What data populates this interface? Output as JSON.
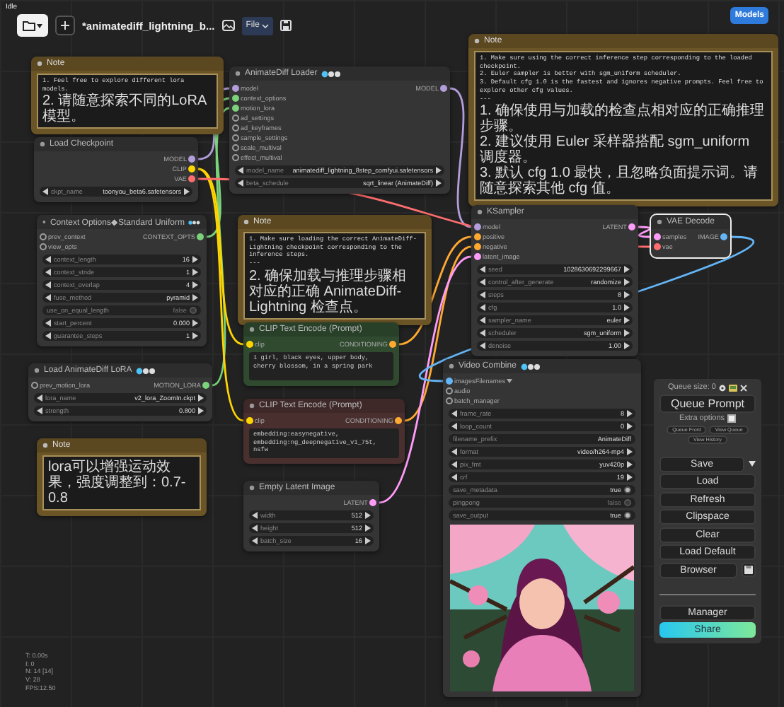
{
  "status": "Idle",
  "toolbar": {
    "workflow_title": "*animatediff_lightning_b...",
    "menu": "File",
    "models_button": "Models"
  },
  "nodes": [
    {
      "kind": "note",
      "title": "Note",
      "color": "#6b5426",
      "selected": false,
      "lines": [
        {
          "kind": "latin",
          "text": "1. Feel free to explore different lora models."
        },
        {
          "kind": "cjk",
          "text": "2. 请随意探索不同的LoRA模型。"
        }
      ]
    },
    {
      "kind": "node",
      "title": "Load Checkpoint",
      "color": "#353535",
      "selected": false,
      "badges": false,
      "outputs": [
        {
          "name": "MODEL",
          "color": "#b39ddb"
        },
        {
          "name": "CLIP",
          "color": "#ffd500"
        },
        {
          "name": "VAE",
          "color": "#ff6e6e"
        }
      ],
      "widgets": [
        {
          "kind": "stepper",
          "name": "ckpt_name",
          "value": "toonyou_beta6.safetensors"
        }
      ]
    },
    {
      "kind": "node",
      "title": "Context Options◆Standard Uniform",
      "color": "#353535",
      "selected": false,
      "badges": true,
      "inputs": [
        {
          "name": "prev_context",
          "color": "#9e9e9e",
          "linked": false
        },
        {
          "name": "view_opts",
          "color": "#9e9e9e",
          "linked": false
        }
      ],
      "outputs": [
        {
          "name": "CONTEXT_OPTS",
          "color": "#7bd37b"
        }
      ],
      "widgets": [
        {
          "kind": "stepper",
          "name": "context_length",
          "value": "16"
        },
        {
          "kind": "stepper",
          "name": "context_stride",
          "value": "1"
        },
        {
          "kind": "stepper",
          "name": "context_overlap",
          "value": "4"
        },
        {
          "kind": "stepper",
          "name": "fuse_method",
          "value": "pyramid"
        },
        {
          "kind": "toggle",
          "name": "use_on_equal_length",
          "value": "false",
          "on": false
        },
        {
          "kind": "stepper",
          "name": "start_percent",
          "value": "0.000"
        },
        {
          "kind": "stepper",
          "name": "guarantee_steps",
          "value": "1"
        }
      ]
    },
    {
      "kind": "node",
      "title": "Load AnimateDiff LoRA",
      "color": "#353535",
      "selected": false,
      "badges": true,
      "inputs": [
        {
          "name": "prev_motion_lora",
          "color": "#9e9e9e",
          "linked": false
        }
      ],
      "outputs": [
        {
          "name": "MOTION_LORA",
          "color": "#7bd37b"
        }
      ],
      "widgets": [
        {
          "kind": "stepper",
          "name": "lora_name",
          "value": "v2_lora_ZoomIn.ckpt"
        },
        {
          "kind": "stepper",
          "name": "strength",
          "value": "0.800"
        }
      ]
    },
    {
      "kind": "note",
      "title": "Note",
      "color": "#6b5426",
      "selected": false,
      "lines": [
        {
          "kind": "cjk",
          "text": "lora可以增强运动效果，强度调整到：0.7-0.8"
        }
      ]
    },
    {
      "kind": "node",
      "title": "AnimateDiff Loader",
      "color": "#353535",
      "selected": false,
      "badges": true,
      "inputs": [
        {
          "name": "model",
          "color": "#b39ddb",
          "linked": true
        },
        {
          "name": "context_options",
          "color": "#7bd37b",
          "linked": true
        },
        {
          "name": "motion_lora",
          "color": "#7bd37b",
          "linked": true
        },
        {
          "name": "ad_settings",
          "color": "#9e9e9e",
          "linked": false
        },
        {
          "name": "ad_keyframes",
          "color": "#9e9e9e",
          "linked": false
        },
        {
          "name": "sample_settings",
          "color": "#9e9e9e",
          "linked": false
        },
        {
          "name": "scale_multival",
          "color": "#9e9e9e",
          "linked": false
        },
        {
          "name": "effect_multival",
          "color": "#9e9e9e",
          "linked": false
        }
      ],
      "outputs": [
        {
          "name": "MODEL",
          "color": "#b39ddb"
        }
      ],
      "widgets": [
        {
          "kind": "stepper",
          "name": "model_name",
          "value": "animatediff_lightning_8step_comfyui.safetensors"
        },
        {
          "kind": "stepper",
          "name": "beta_schedule",
          "value": "sqrt_linear (AnimateDiff)"
        }
      ]
    },
    {
      "kind": "note",
      "title": "Note",
      "color": "#6b5426",
      "selected": false,
      "lines": [
        {
          "kind": "latin",
          "text": "1. Make sure loading the correct AnimateDiff-Lightning checkpoint corresponding to the inference steps."
        },
        {
          "kind": "latin",
          "text": "---"
        },
        {
          "kind": "cjk",
          "text": "2. 确保加载与推理步骤相对应的正确 AnimateDiff-Lightning 检查点。"
        }
      ]
    },
    {
      "kind": "node",
      "title": "CLIP Text Encode (Prompt)",
      "color": "#2f4a2f",
      "selected": false,
      "badges": false,
      "inputs": [
        {
          "name": "clip",
          "color": "#ffd500",
          "linked": true
        }
      ],
      "outputs": [
        {
          "name": "CONDITIONING",
          "color": "#ffa931"
        }
      ],
      "widgets": [
        {
          "kind": "prompt",
          "value": "1 girl, black eyes, upper body, cherry blossom, in a spring park"
        }
      ]
    },
    {
      "kind": "node",
      "title": "CLIP Text Encode (Prompt)",
      "color": "#4a2f2f",
      "selected": false,
      "badges": false,
      "inputs": [
        {
          "name": "clip",
          "color": "#ffd500",
          "linked": true
        }
      ],
      "outputs": [
        {
          "name": "CONDITIONING",
          "color": "#ffa931"
        }
      ],
      "widgets": [
        {
          "kind": "prompt",
          "value": "embedding:easynegative, embedding:ng_deepnegative_v1_75t, nsfw"
        }
      ]
    },
    {
      "kind": "node",
      "title": "Empty Latent Image",
      "color": "#353535",
      "selected": false,
      "badges": false,
      "outputs": [
        {
          "name": "LATENT",
          "color": "#ff9cf9"
        }
      ],
      "widgets": [
        {
          "kind": "stepper",
          "name": "width",
          "value": "512"
        },
        {
          "kind": "stepper",
          "name": "height",
          "value": "512"
        },
        {
          "kind": "stepper",
          "name": "batch_size",
          "value": "16"
        }
      ]
    },
    {
      "kind": "note",
      "title": "Note",
      "color": "#6b5426",
      "selected": false,
      "lines": [
        {
          "kind": "latin",
          "text": "1. Make sure using the correct inference step corresponding to the loaded checkpoint."
        },
        {
          "kind": "latin",
          "text": "2. Euler sampler is better with sgm_uniform scheduler."
        },
        {
          "kind": "latin",
          "text": "3. Default cfg 1.0 is the fastest and ignores negative prompts. Feel free to explore other cfg values."
        },
        {
          "kind": "latin",
          "text": "---"
        },
        {
          "kind": "cjk",
          "text": "1. 确保使用与加载的检查点相对应的正确推理步骤。"
        },
        {
          "kind": "cjk",
          "text": "2. 建议使用 Euler 采样器搭配 sgm_uniform 调度器。"
        },
        {
          "kind": "cjk",
          "text": "3. 默认 cfg 1.0 最快，且忽略负面提示词。请随意探索其他 cfg 值。"
        }
      ]
    },
    {
      "kind": "node",
      "title": "KSampler",
      "color": "#353535",
      "selected": false,
      "badges": false,
      "inputs": [
        {
          "name": "model",
          "color": "#b39ddb",
          "linked": true
        },
        {
          "name": "positive",
          "color": "#ffa931",
          "linked": true
        },
        {
          "name": "negative",
          "color": "#ffa931",
          "linked": true
        },
        {
          "name": "latent_image",
          "color": "#ff9cf9",
          "linked": true
        }
      ],
      "outputs": [
        {
          "name": "LATENT",
          "color": "#ff9cf9"
        }
      ],
      "widgets": [
        {
          "kind": "stepper",
          "name": "seed",
          "value": "1028630692299667"
        },
        {
          "kind": "stepper",
          "name": "control_after_generate",
          "value": "randomize"
        },
        {
          "kind": "stepper",
          "name": "steps",
          "value": "8"
        },
        {
          "kind": "stepper",
          "name": "cfg",
          "value": "1.0"
        },
        {
          "kind": "stepper",
          "name": "sampler_name",
          "value": "euler"
        },
        {
          "kind": "stepper",
          "name": "scheduler",
          "value": "sgm_uniform"
        },
        {
          "kind": "stepper",
          "name": "denoise",
          "value": "1.00"
        }
      ]
    },
    {
      "kind": "node",
      "title": "VAE Decode",
      "color": "#353535",
      "selected": true,
      "badges": false,
      "inputs": [
        {
          "name": "samples",
          "color": "#ff9cf9",
          "linked": true
        },
        {
          "name": "vae",
          "color": "#ff6e6e",
          "linked": true
        }
      ],
      "outputs": [
        {
          "name": "IMAGE",
          "color": "#64b5f6"
        }
      ]
    },
    {
      "kind": "node",
      "title": "Video Combine",
      "color": "#353535",
      "selected": false,
      "badges": true,
      "inputs": [
        {
          "name": "images",
          "color": "#64b5f6",
          "linked": true,
          "menu": "Filenames"
        },
        {
          "name": "audio",
          "color": "#9e9e9e",
          "linked": false
        },
        {
          "name": "batch_manager",
          "color": "#9e9e9e",
          "linked": false
        }
      ],
      "widgets": [
        {
          "kind": "stepper",
          "name": "frame_rate",
          "value": "8"
        },
        {
          "kind": "stepper",
          "name": "loop_count",
          "value": "0"
        },
        {
          "kind": "field",
          "name": "filename_prefix",
          "value": "AnimateDiff"
        },
        {
          "kind": "stepper",
          "name": "format",
          "value": "video/h264-mp4"
        },
        {
          "kind": "stepper",
          "name": "pix_fmt",
          "value": "yuv420p"
        },
        {
          "kind": "stepper",
          "name": "crf",
          "value": "19"
        },
        {
          "kind": "toggle",
          "name": "save_metadata",
          "value": "true",
          "on": true
        },
        {
          "kind": "toggle",
          "name": "pingpong",
          "value": "false",
          "on": false
        },
        {
          "kind": "toggle",
          "name": "save_output",
          "value": "true",
          "on": true
        }
      ],
      "preview": {
        "kind": "picture"
      }
    }
  ],
  "queue_panel": {
    "queue_size": "Queue size: 0",
    "queue_button": "Queue Prompt",
    "extra_options": {
      "label": "Extra options",
      "checked": false
    },
    "small_buttons": [
      "Queue Front",
      "View Queue",
      "View History"
    ],
    "buttons": [
      {
        "label": "Save",
        "kind": "split"
      },
      {
        "label": "Load",
        "kind": "plain"
      },
      {
        "label": "Refresh",
        "kind": "plain"
      },
      {
        "label": "Clipspace",
        "kind": "plain"
      },
      {
        "label": "Clear",
        "kind": "plain"
      },
      {
        "label": "Load Default",
        "kind": "plain"
      },
      {
        "label": "Browser",
        "kind": "with-icon"
      }
    ],
    "manager_button": "Manager",
    "share_button": "Share"
  },
  "stats": [
    "T: 0.00s",
    "I: 0",
    "N: 14 [14]",
    "V: 28",
    "FPS:12.50"
  ]
}
